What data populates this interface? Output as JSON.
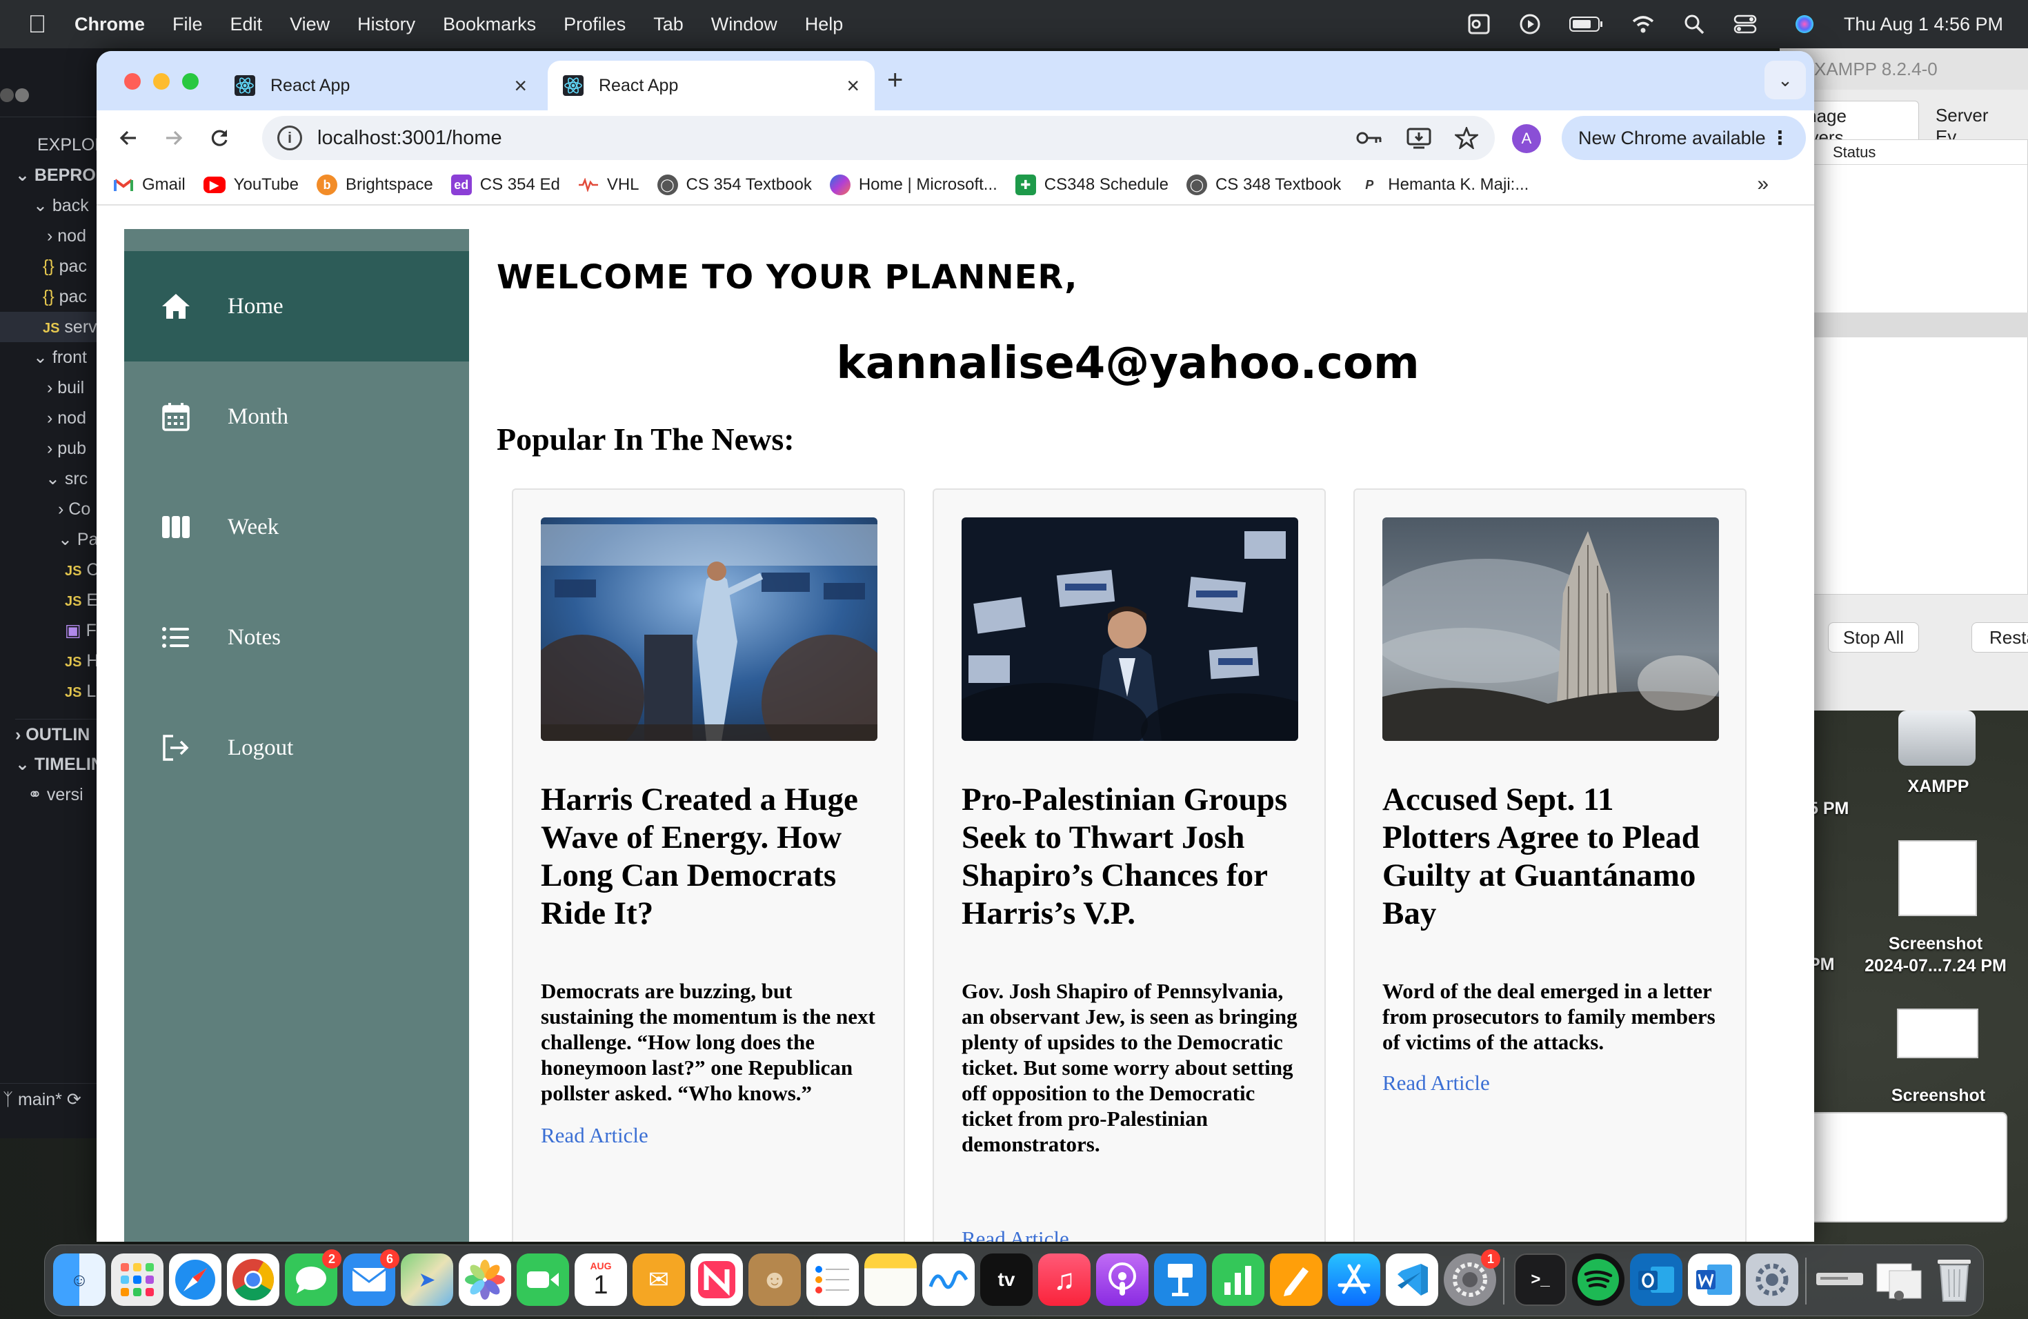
{
  "menubar": {
    "items": [
      "Chrome",
      "File",
      "Edit",
      "View",
      "History",
      "Bookmarks",
      "Profiles",
      "Tab",
      "Window",
      "Help"
    ],
    "clock": "Thu Aug 1  4:56 PM"
  },
  "vscode": {
    "explorer_label": "EXPLOR",
    "rows": [
      "BEPROD",
      "back",
      "nod",
      "pac",
      "pac",
      "serv",
      "front",
      "buil",
      "nod",
      "pub",
      "src",
      "Co",
      "Pa",
      "C",
      "E",
      "F",
      "H",
      "L",
      "OUTLIN",
      "TIMELIN",
      "versi"
    ],
    "branch": "main*"
  },
  "xampp": {
    "title": "XAMPP 8.2.4-0",
    "tabs": [
      "Manage Servers",
      "Server Ev"
    ],
    "list_header": "Status",
    "buttons": [
      "Stop All",
      "Resta"
    ]
  },
  "desktop": {
    "icons": [
      "XAMPP",
      "Screenshot\n2024-07...7.24 PM",
      "Screenshot"
    ],
    "left_labels": [
      "5 PM",
      "PM"
    ]
  },
  "chrome": {
    "tabs": [
      {
        "title": "React App",
        "active": false
      },
      {
        "title": "React App",
        "active": true
      }
    ],
    "url": "localhost:3001/home",
    "profile_initial": "A",
    "update_label": "New Chrome available",
    "bookmarks": [
      "Gmail",
      "YouTube",
      "Brightspace",
      "CS 354 Ed",
      "VHL",
      "CS 354 Textbook",
      "Home | Microsoft...",
      "CS348 Schedule",
      "CS 348 Textbook",
      "Hemanta K. Maji:..."
    ]
  },
  "app": {
    "nav": [
      {
        "label": "Home",
        "icon": "home-icon",
        "active": true
      },
      {
        "label": "Month",
        "icon": "calendar-icon",
        "active": false
      },
      {
        "label": "Week",
        "icon": "week-columns-icon",
        "active": false
      },
      {
        "label": "Notes",
        "icon": "list-icon",
        "active": false
      },
      {
        "label": "Logout",
        "icon": "logout-icon",
        "active": false
      }
    ],
    "welcome": "WELCOME TO YOUR PLANNER,",
    "email": "kannalise4@yahoo.com",
    "news_heading": "Popular In The News:",
    "articles": [
      {
        "title": "Harris Created a Huge Wave of Energy. How Long Can Democrats Ride It?",
        "summary": "Democrats are buzzing, but sustaining the momentum is the next challenge. “How long does the honeymoon last?” one Republican pollster asked. “Who knows.”",
        "link": "Read Article"
      },
      {
        "title": "Pro-Palestinian Groups Seek to Thwart Josh Shapiro’s Chances for Harris’s V.P.",
        "summary": "Gov. Josh Shapiro of Pennsylvania, an observant Jew, is seen as bringing plenty of upsides to the Democratic ticket. But some worry about setting off opposition to the Democratic ticket from pro-Palestinian demonstrators.",
        "link": "Read Article"
      },
      {
        "title": "Accused Sept. 11 Plotters Agree to Plead Guilty at Guantánamo Bay",
        "summary": "Word of the deal emerged in a letter from prosecutors to family members of victims of the attacks.",
        "link": "Read Article"
      }
    ],
    "colors": {
      "sidebar": "#5f7f7c",
      "sidebar_active": "#2d5c58",
      "link": "#3b6fd4"
    }
  },
  "dock": {
    "apps": [
      "finder-icon",
      "launchpad-icon",
      "safari-icon",
      "chrome-icon",
      "messages-icon",
      "mail-icon",
      "maps-icon",
      "photos-icon",
      "facetime-icon",
      "calendar-icon",
      "keynote-icon",
      "news-icon",
      "contacts-icon",
      "reminders-icon",
      "notes-icon",
      "freeform-icon",
      "tv-icon",
      "music-icon",
      "podcasts-icon",
      "keynote-podium-icon",
      "numbers-icon",
      "pages-icon",
      "app-store-icon",
      "vscode-icon",
      "system-settings-icon",
      "terminal-icon",
      "spotify-icon",
      "outlook-icon",
      "word-icon",
      "settings-gear-icon",
      "preview-icon",
      "downloads-stack-icon",
      "trash-icon"
    ],
    "badges": {
      "messages": "2",
      "mail": "6",
      "system-settings": "1"
    },
    "calendar_month": "AUG",
    "calendar_day": "1",
    "tv_label": "tv"
  }
}
